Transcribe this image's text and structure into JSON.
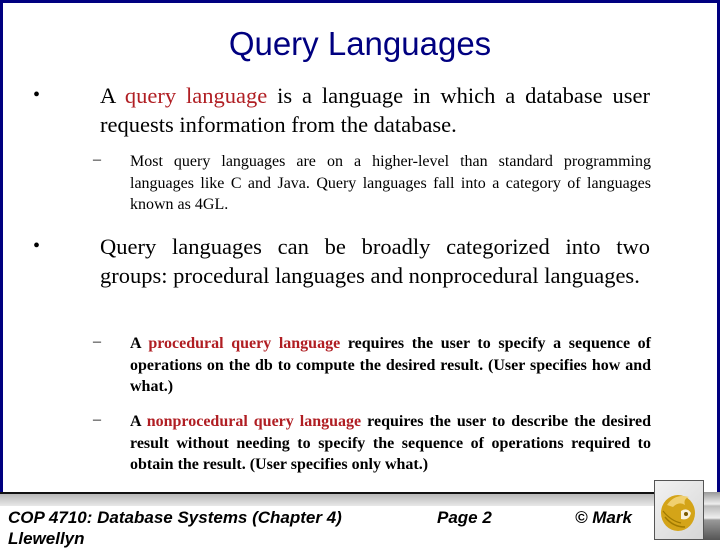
{
  "slide": {
    "title": "Query Languages",
    "bullets": [
      {
        "marker": "•",
        "parts": [
          {
            "text": "A ",
            "highlight": false
          },
          {
            "text": "query language",
            "highlight": true
          },
          {
            "text": " is a language in which a database user requests information from the database.",
            "highlight": false
          }
        ],
        "sub": [
          {
            "marker": "–",
            "parts": [
              {
                "text": "Most query languages are on a higher-level than standard programming languages like C and Java.  Query languages fall into a category of languages known as 4GL.",
                "highlight": false
              }
            ]
          }
        ]
      },
      {
        "marker": "•",
        "parts": [
          {
            "text": "Query languages can be broadly categorized into two groups:  procedural languages and nonprocedural languages.",
            "highlight": false
          }
        ],
        "sub": [
          {
            "marker": "–",
            "parts": [
              {
                "text": "A ",
                "highlight": false
              },
              {
                "text": "procedural query language",
                "highlight": true
              },
              {
                "text": " requires the user to specify a sequence of operations on the db to compute the desired result.  (User specifies how and what.)",
                "highlight": false
              }
            ]
          },
          {
            "marker": "–",
            "parts": [
              {
                "text": "A ",
                "highlight": false
              },
              {
                "text": "nonprocedural query language",
                "highlight": true
              },
              {
                "text": " requires the user to describe the desired result without needing to specify the  sequence of operations required to obtain the result. (User specifies only what.)",
                "highlight": false
              }
            ]
          }
        ]
      }
    ]
  },
  "footer": {
    "course": "COP 4710: Database Systems  (Chapter 4)",
    "page": "Page 2",
    "copyright": "© Mark",
    "author_overflow": "Llewellyn",
    "logo_icon": "pegasus-logo-icon"
  },
  "colors": {
    "frame": "#000080",
    "title": "#000080",
    "highlight": "#b01e23",
    "logo_gold": "#d4a418"
  }
}
